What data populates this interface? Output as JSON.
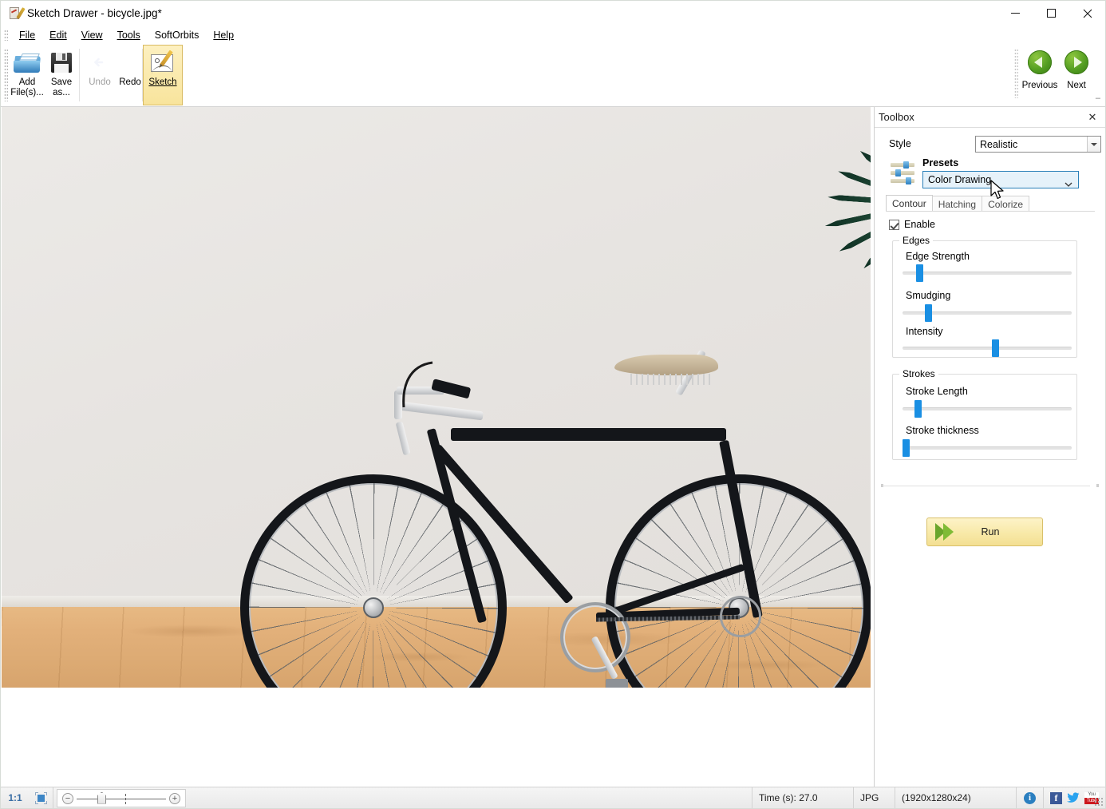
{
  "window": {
    "title": "Sketch Drawer - bicycle.jpg*",
    "icon": "sketch-drawer-app-icon",
    "minimize_label": "Minimize",
    "maximize_label": "Maximize",
    "close_label": "Close"
  },
  "menubar": {
    "items": [
      {
        "label": "File"
      },
      {
        "label": "Edit"
      },
      {
        "label": "View"
      },
      {
        "label": "Tools"
      },
      {
        "label": "SoftOrbits"
      },
      {
        "label": "Help"
      }
    ]
  },
  "toolbar": {
    "add_files_line1": "Add",
    "add_files_line2": "File(s)...",
    "save_as_line1": "Save",
    "save_as_line2": "as...",
    "undo_label": "Undo",
    "redo_label": "Redo",
    "sketch_label": "Sketch",
    "expand_glyph": "–",
    "previous_label": "Previous",
    "next_label": "Next"
  },
  "toolbox": {
    "title": "Toolbox",
    "close_glyph": "✕",
    "style_label": "Style",
    "style_value": "Realistic",
    "presets_label": "Presets",
    "presets_value": "Color Drawing",
    "tabs": [
      {
        "label": "Contour",
        "active": true
      },
      {
        "label": "Hatching",
        "active": false
      },
      {
        "label": "Colorize",
        "active": false
      }
    ],
    "enable_label": "Enable",
    "edges_group_label": "Edges",
    "strokes_group_label": "Strokes",
    "sliders": [
      {
        "label": "Edge Strength",
        "percent": 10
      },
      {
        "label": "Smudging",
        "percent": 15
      },
      {
        "label": "Intensity",
        "percent": 55
      },
      {
        "label": "Stroke Length",
        "percent": 9
      },
      {
        "label": "Stroke thickness",
        "percent": 1
      }
    ],
    "run_label": "Run"
  },
  "statusbar": {
    "ratio": "1:1",
    "fit_icon": "fit-to-window-icon",
    "zoom_minus": "−",
    "zoom_plus": "+",
    "time": "Time (s): 27.0",
    "format": "JPG",
    "dimensions": "(1920x1280x24)",
    "info_glyph": "i",
    "facebook_glyph": "f",
    "youtube_top": "You",
    "youtube_bottom": "Tube"
  },
  "canvas": {
    "image_name": "bicycle.jpg",
    "description": "Black vintage road bicycle leaning against a light grey wall on a pine wood floor with a dark green yucca plant at the right"
  }
}
